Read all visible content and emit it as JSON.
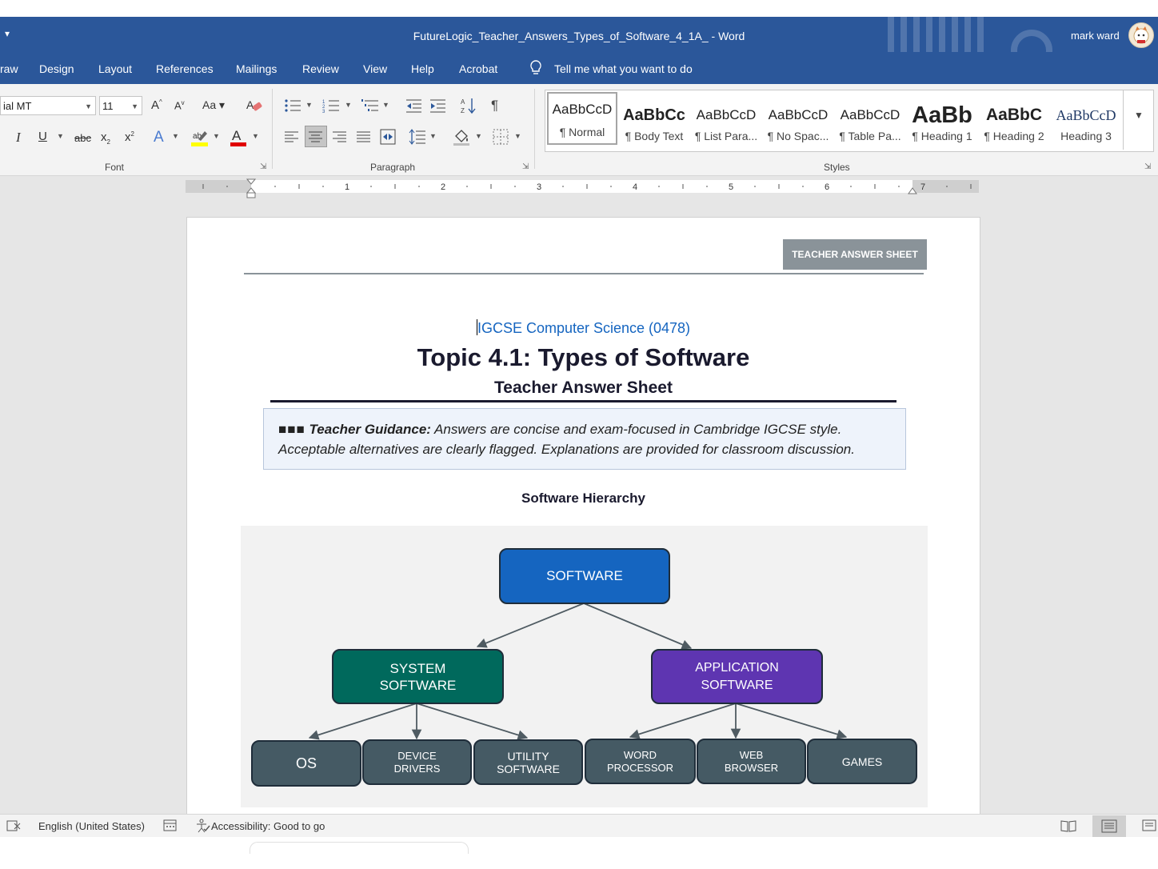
{
  "window": {
    "title": "FutureLogic_Teacher_Answers_Types_of_Software_4_1A_  -  Word",
    "user": "mark ward"
  },
  "menu": {
    "tabs": [
      "raw",
      "Design",
      "Layout",
      "References",
      "Mailings",
      "Review",
      "View",
      "Help",
      "Acrobat"
    ],
    "tell_me": "Tell me what you want to do"
  },
  "ribbon": {
    "font_name": "ial MT",
    "font_size": "11",
    "groups": {
      "font": "Font",
      "paragraph": "Paragraph",
      "styles": "Styles"
    },
    "styles": [
      {
        "sample": "AaBbCcD",
        "name": "¶ Normal"
      },
      {
        "sample": "AaBbCc",
        "name": "¶ Body Text"
      },
      {
        "sample": "AaBbCcD",
        "name": "¶ List Para..."
      },
      {
        "sample": "AaBbCcD",
        "name": "¶ No Spac..."
      },
      {
        "sample": "AaBbCcD",
        "name": "¶ Table Pa..."
      },
      {
        "sample": "AaBb",
        "name": "¶ Heading 1"
      },
      {
        "sample": "AaBbC",
        "name": "¶ Heading 2"
      },
      {
        "sample": "AaBbCcD",
        "name": "Heading 3"
      }
    ]
  },
  "ruler": {
    "numbers": [
      "1",
      "2",
      "3",
      "4",
      "5",
      "6",
      "7"
    ]
  },
  "document": {
    "badge": "TEACHER ANSWER SHEET",
    "course": "IGCSE Computer Science (0478)",
    "title": "Topic 4.1: Types of Software",
    "subtitle": "Teacher Answer Sheet",
    "guidance_label": "Teacher Guidance:",
    "guidance_text": " Answers are concise and exam-focused in Cambridge IGCSE style. Acceptable alternatives are clearly flagged. Explanations are provided for classroom discussion.",
    "diagram_heading": "Software Hierarchy",
    "diagram": {
      "root": "SOFTWARE",
      "system": "SYSTEM SOFTWARE",
      "application": "APPLICATION SOFTWARE",
      "system_children": [
        "OS",
        "DEVICE DRIVERS",
        "UTILITY SOFTWARE"
      ],
      "application_children": [
        "WORD PROCESSOR",
        "WEB BROWSER",
        "GAMES"
      ],
      "colors": {
        "root": "#1565c0",
        "system": "#00695c",
        "application": "#5e35b1",
        "leaf": "#455a64",
        "background": "#f2f2f2"
      }
    }
  },
  "status": {
    "language": "English (United States)",
    "accessibility": "Accessibility: Good to go"
  },
  "colors": {
    "word_blue": "#2b579a"
  }
}
